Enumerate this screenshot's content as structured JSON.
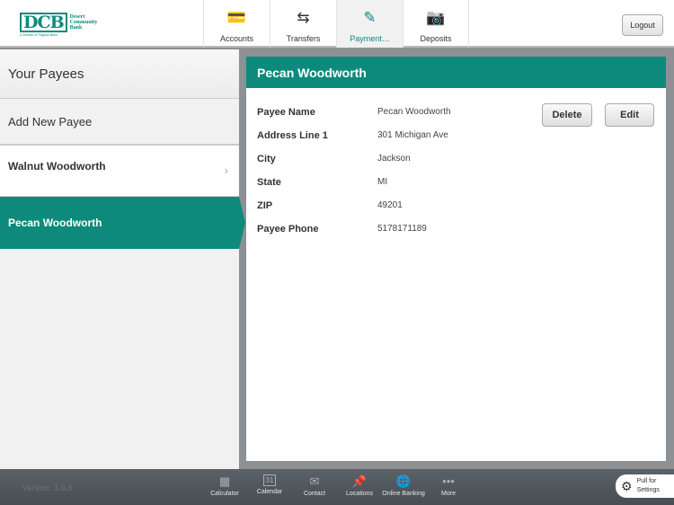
{
  "header": {
    "logo": {
      "mark": "DCB",
      "name": "Desert Community Bank",
      "sub": "A Division of Flagstar Bank"
    },
    "tabs": [
      {
        "label": "Accounts",
        "icon": "credit-card-icon"
      },
      {
        "label": "Transfers",
        "icon": "transfer-arrows-icon"
      },
      {
        "label": "Payment…",
        "icon": "check-pen-icon",
        "active": true
      },
      {
        "label": "Deposits",
        "icon": "camera-icon"
      }
    ],
    "logout": "Logout"
  },
  "sidebar": {
    "title": "Your Payees",
    "add": "Add New Payee",
    "items": [
      {
        "label": "Walnut Woodworth"
      },
      {
        "label": "Pecan Woodworth",
        "selected": true
      }
    ]
  },
  "detail": {
    "title": "Pecan Woodworth",
    "delete": "Delete",
    "edit": "Edit",
    "fields": [
      {
        "k": "Payee Name",
        "v": "Pecan Woodworth"
      },
      {
        "k": "Address Line 1",
        "v": "301 Michigan Ave"
      },
      {
        "k": "City",
        "v": "Jackson"
      },
      {
        "k": "State",
        "v": "MI"
      },
      {
        "k": "ZIP",
        "v": "49201"
      },
      {
        "k": "Payee Phone",
        "v": "5178171189"
      }
    ]
  },
  "footer": {
    "version": "Version: 3.0.3",
    "items": [
      {
        "label": "Calculator",
        "icon": "calculator-icon"
      },
      {
        "label": "Calendar",
        "icon": "calendar-icon",
        "glyph": "31"
      },
      {
        "label": "Contact",
        "icon": "envelope-icon"
      },
      {
        "label": "Locations",
        "icon": "pin-icon"
      },
      {
        "label": "Online Banking",
        "icon": "globe-icon"
      },
      {
        "label": "More",
        "icon": "more-icon"
      }
    ],
    "pull": {
      "line1": "Pull for",
      "line2": "Settings"
    }
  },
  "colors": {
    "accent": "#0e8a7d"
  }
}
